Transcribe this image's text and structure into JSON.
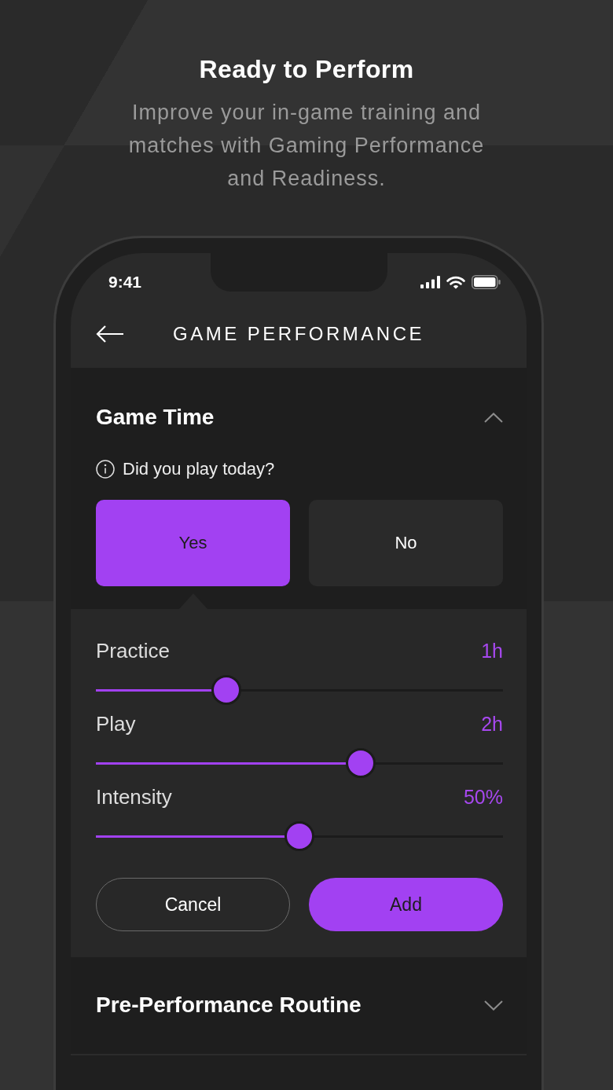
{
  "hero": {
    "title": "Ready to Perform",
    "subtitle": "Improve your in-game training and matches with Gaming Performance and Readiness."
  },
  "status_bar": {
    "time": "9:41"
  },
  "nav": {
    "title": "GAME PERFORMANCE"
  },
  "sections": [
    {
      "title": "Game Time",
      "expanded": true,
      "question": "Did you play today?",
      "choices": [
        {
          "label": "Yes",
          "selected": true
        },
        {
          "label": "No",
          "selected": false
        }
      ],
      "sliders": [
        {
          "label": "Practice",
          "reading": "1h",
          "level": 0.32
        },
        {
          "label": "Play",
          "reading": "2h",
          "level": 0.65
        },
        {
          "label": "Intensity",
          "reading": "50%",
          "level": 0.5
        }
      ],
      "buttons": [
        {
          "label": "Cancel",
          "kind": "cancel"
        },
        {
          "label": "Add",
          "kind": "add"
        }
      ]
    },
    {
      "title": "Pre-Performance Routine",
      "expanded": false
    }
  ]
}
